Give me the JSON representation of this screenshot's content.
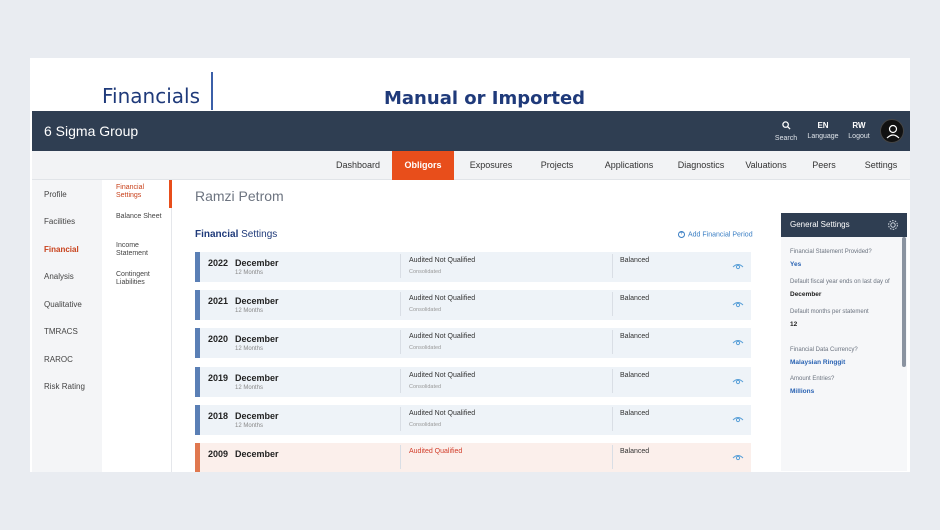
{
  "slide": {
    "title_left": "Financials",
    "title_center": "Manual or Imported"
  },
  "topbar": {
    "brand": "6 Sigma Group",
    "search_label": "Search",
    "language_code": "EN",
    "language_label": "Language",
    "user_initials": "RW",
    "logout_label": "Logout"
  },
  "nav": {
    "items": [
      "Dashboard",
      "Obligors",
      "Exposures",
      "Projects",
      "Applications",
      "Diagnostics",
      "Valuations",
      "Peers",
      "Settings"
    ],
    "active": "Obligors"
  },
  "left_menu": {
    "items": [
      "Profile",
      "Facilities",
      "Financial",
      "Analysis",
      "Qualitative",
      "TMRACS",
      "RAROC",
      "Risk Rating"
    ],
    "active": "Financial"
  },
  "sub_menu": {
    "items": [
      "Financial Settings",
      "Balance Sheet",
      "Income Statement",
      "Contingent Liabilities"
    ],
    "active": "Financial Settings"
  },
  "main": {
    "client_name": "Ramzi Petrom",
    "section_title_bold": "Financial",
    "section_title_light": "Settings",
    "add_period_label": "Add Financial Period",
    "rows": [
      {
        "year": "2022",
        "month": "December",
        "months": "12 Months",
        "audit": "Audited Not Qualified",
        "consolidation": "Consolidated",
        "balance": "Balanced"
      },
      {
        "year": "2021",
        "month": "December",
        "months": "12 Months",
        "audit": "Audited Not Qualified",
        "consolidation": "Consolidated",
        "balance": "Balanced"
      },
      {
        "year": "2020",
        "month": "December",
        "months": "12 Months",
        "audit": "Audited Not Qualified",
        "consolidation": "Consolidated",
        "balance": "Balanced"
      },
      {
        "year": "2019",
        "month": "December",
        "months": "12 Months",
        "audit": "Audited Not Qualified",
        "consolidation": "Consolidated",
        "balance": "Balanced"
      },
      {
        "year": "2018",
        "month": "December",
        "months": "12 Months",
        "audit": "Audited Not Qualified",
        "consolidation": "Consolidated",
        "balance": "Balanced"
      },
      {
        "year": "2009",
        "month": "December",
        "months": "",
        "audit": "Audited Qualified",
        "consolidation": "",
        "balance": "Balanced"
      }
    ]
  },
  "general_settings": {
    "title": "General Settings",
    "fields": [
      {
        "question": "Financial Statement Provided?",
        "answer": "Yes"
      },
      {
        "question": "Default fiscal year ends on last day of",
        "answer": "December"
      },
      {
        "question": "Default months per statement",
        "answer": "12"
      },
      {
        "question": "Financial Data Currency?",
        "answer": "Malaysian Ringgit"
      },
      {
        "question": "Amount Entries?",
        "answer": "Millions"
      }
    ]
  },
  "colors": {
    "topbar": "#2f3e52",
    "accent": "#e84e1b",
    "title_blue": "#1f3a7a",
    "row_bar": "#5a7fb5",
    "row_bar_alt": "#e0784f"
  }
}
